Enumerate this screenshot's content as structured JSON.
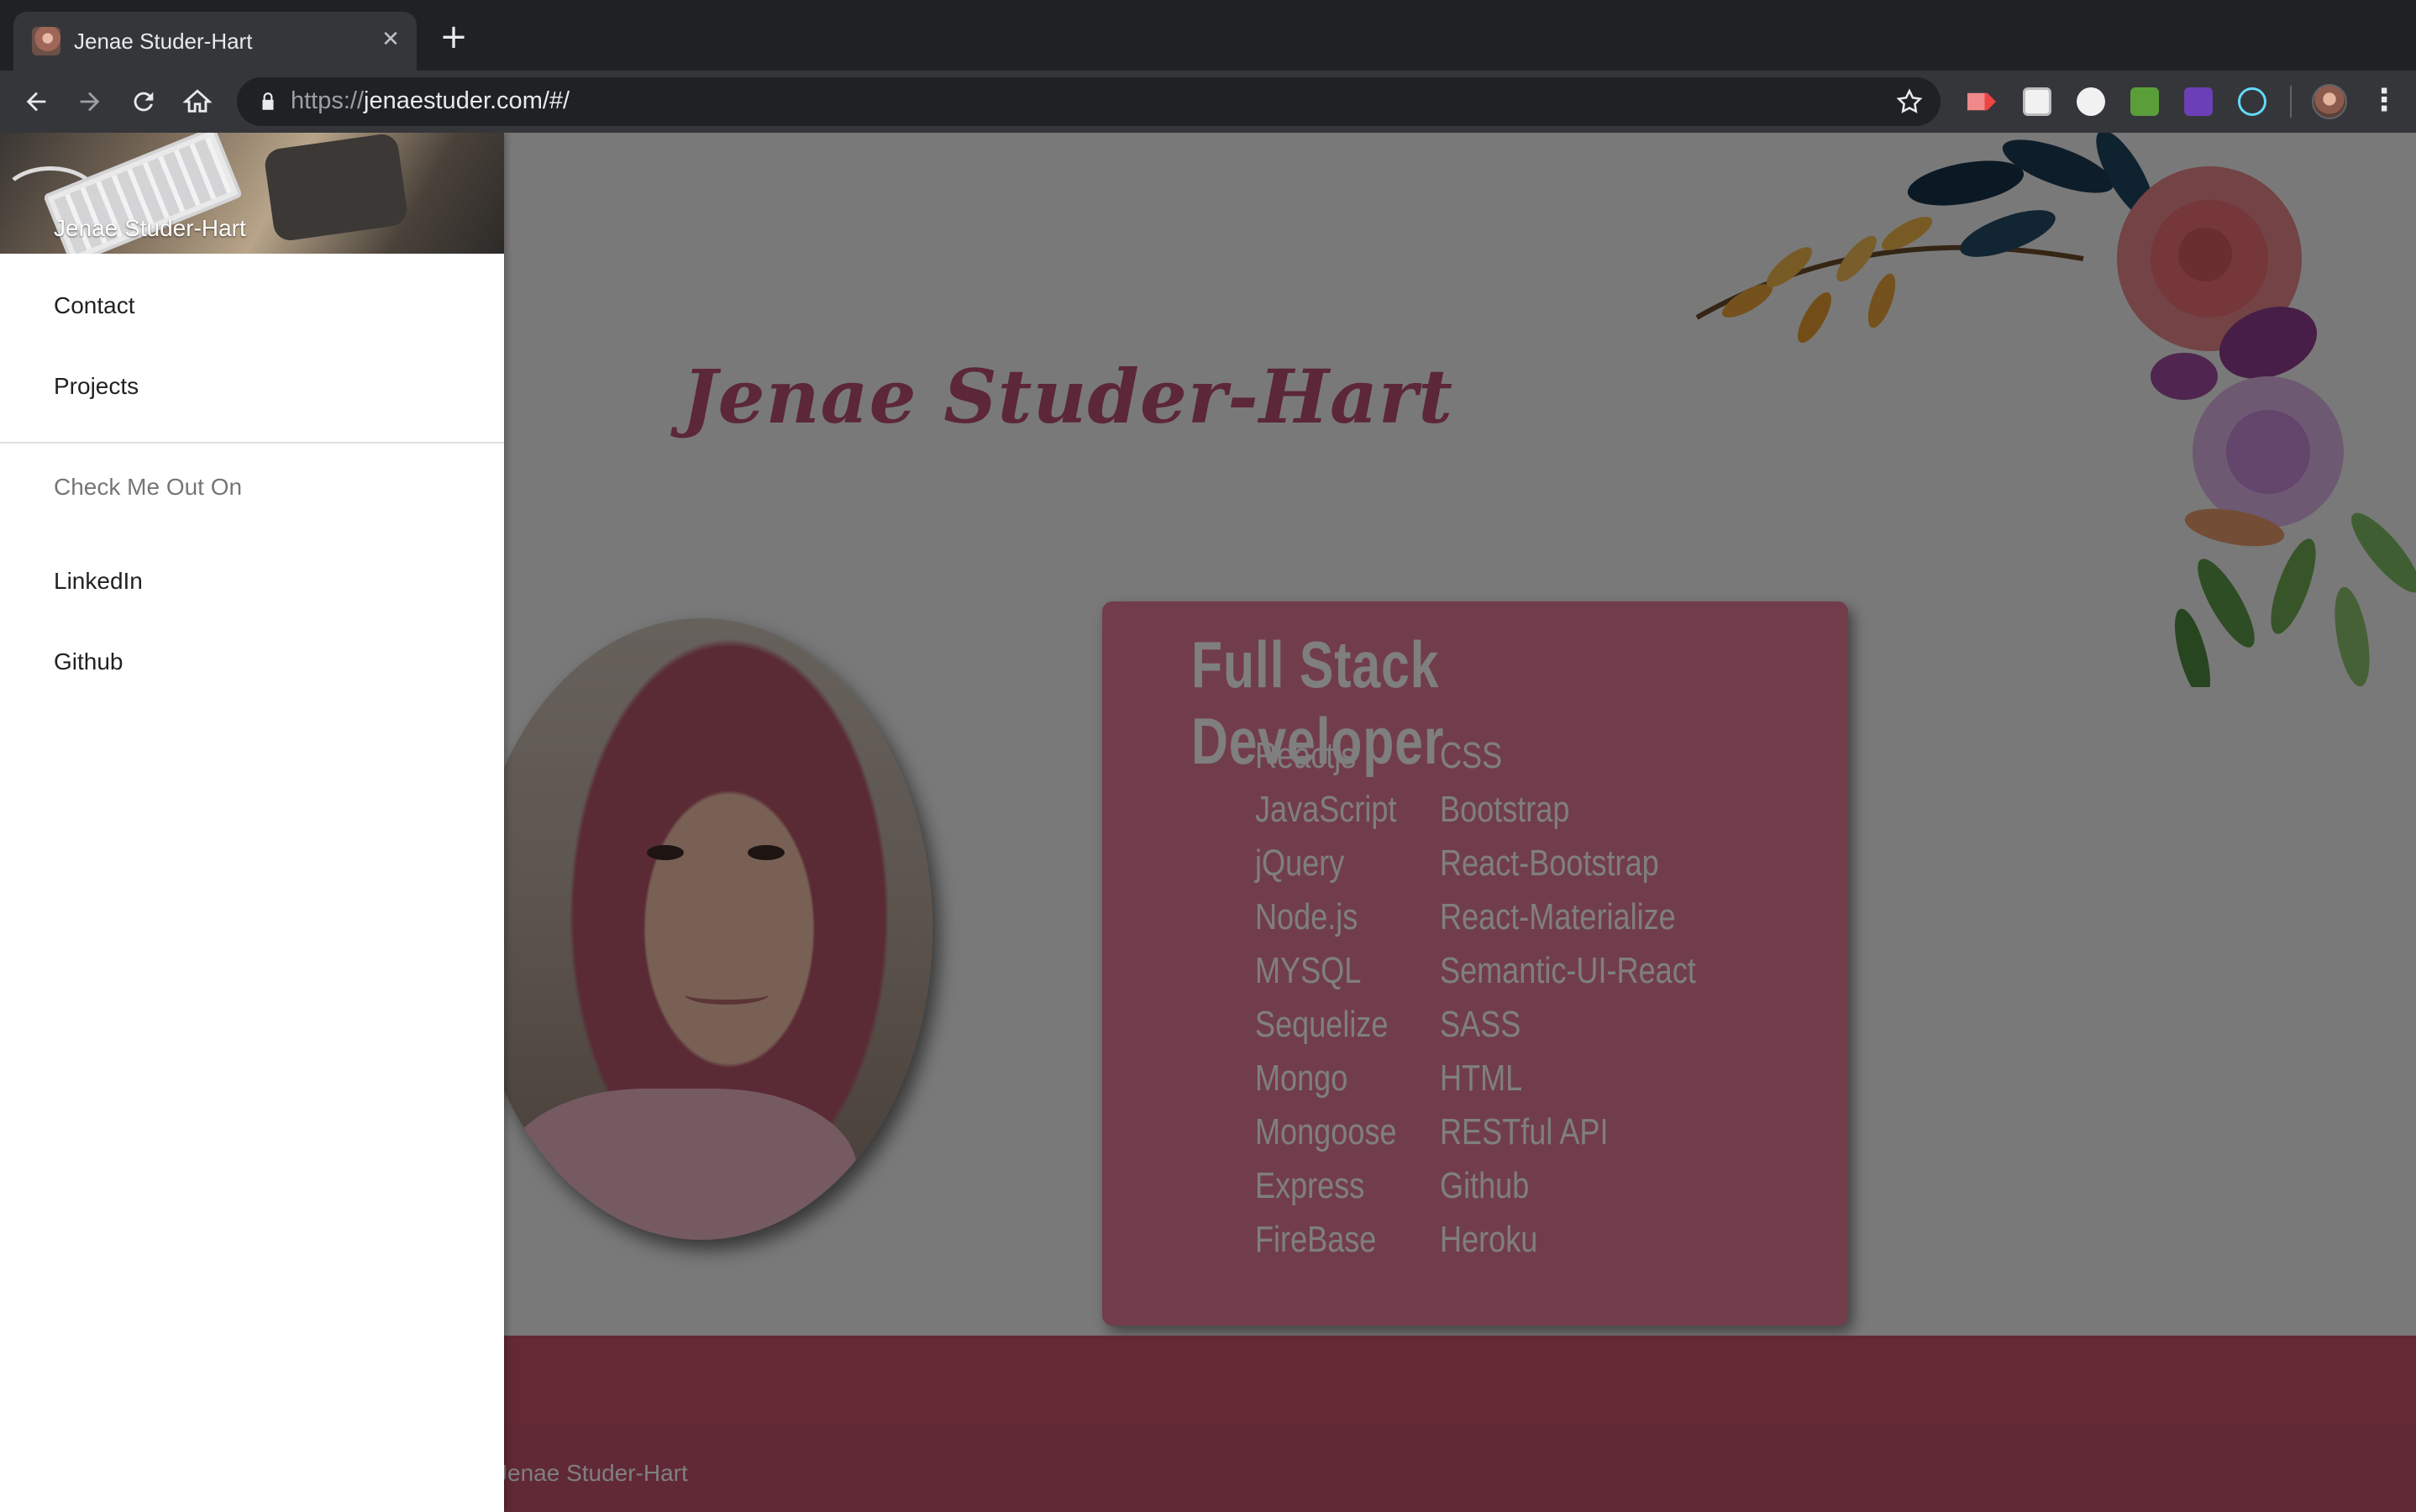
{
  "browser": {
    "tab_title": "Jenae Studer-Hart",
    "close_tab_glyph": "✕",
    "new_tab_glyph": "+",
    "url_scheme": "https://",
    "url_rest": "jenaestuder.com/#/",
    "menu_glyph": "⋮",
    "extensions": [
      "video-recorder-icon",
      "clipboard-icon",
      "code-viewer-icon",
      "cors-icon",
      "checkmark-extension-icon",
      "react-devtools-icon"
    ]
  },
  "sidenav": {
    "header_name": "Jenae Studer-Hart",
    "items": [
      {
        "label": "Contact"
      },
      {
        "label": "Projects"
      }
    ],
    "subheader": "Check Me Out On",
    "social": [
      {
        "label": "LinkedIn"
      },
      {
        "label": "Github"
      }
    ]
  },
  "main": {
    "title": "Jenae Studer-Hart",
    "skills_heading": "Full Stack Developer",
    "skills_left": [
      "Reactjs",
      "JavaScript",
      "jQuery",
      "Node.js",
      "MYSQL",
      "Sequelize",
      "Mongo",
      "Mongoose",
      "Express",
      "FireBase"
    ],
    "skills_right": [
      "CSS",
      "Bootstrap",
      "React-Bootstrap",
      "React-Materialize",
      "Semantic-UI-React",
      "SASS",
      "HTML",
      "RESTful API",
      "Github",
      "Heroku"
    ]
  },
  "footer": {
    "text": "Jenae Studer-Hart"
  },
  "colors": {
    "accent_pink": "#e47a97",
    "title_pink": "#b84e70",
    "footer": "#c9536b",
    "chrome_dark": "#202124",
    "chrome_toolbar": "#35363a"
  }
}
